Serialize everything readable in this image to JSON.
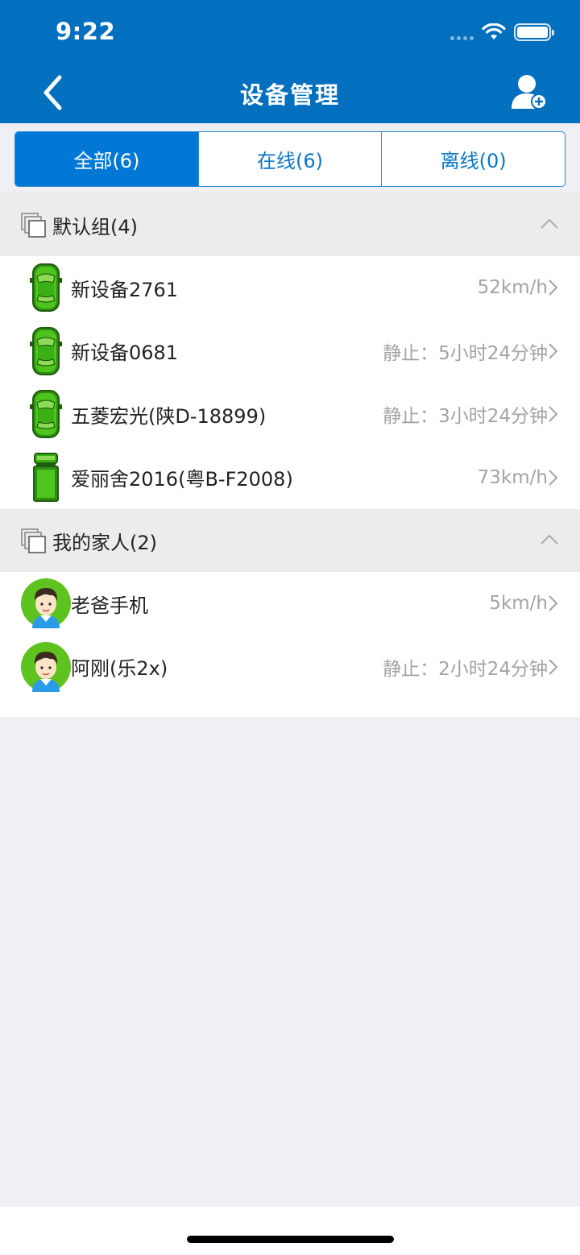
{
  "status_bar": {
    "time": "9:22"
  },
  "header": {
    "title": "设备管理"
  },
  "tabs": [
    {
      "label": "全部(6)",
      "active": true
    },
    {
      "label": "在线(6)",
      "active": false
    },
    {
      "label": "离线(0)",
      "active": false
    }
  ],
  "groups": [
    {
      "title": "默认组(4)",
      "items": [
        {
          "name": "新设备2761",
          "status": "52km/h",
          "icon": "car-icon"
        },
        {
          "name": "新设备0681",
          "status": "静止：5小时24分钟",
          "icon": "car-icon"
        },
        {
          "name": "五菱宏光(陕D-18899)",
          "status": "静止：3小时24分钟",
          "icon": "car-icon"
        },
        {
          "name": "爱丽舍2016(粤B-F2008)",
          "status": "73km/h",
          "icon": "truck-icon"
        }
      ]
    },
    {
      "title": "我的家人(2)",
      "items": [
        {
          "name": "老爸手机",
          "status": "5km/h",
          "icon": "person-avatar"
        },
        {
          "name": "阿刚(乐2x)",
          "status": "静止：2小时24分钟",
          "icon": "person-avatar"
        }
      ]
    }
  ],
  "colors": {
    "header": "#0270be",
    "active_tab": "#0278d6",
    "vehicle_green": "#3fb51c",
    "avatar_green": "#5ec21f"
  }
}
